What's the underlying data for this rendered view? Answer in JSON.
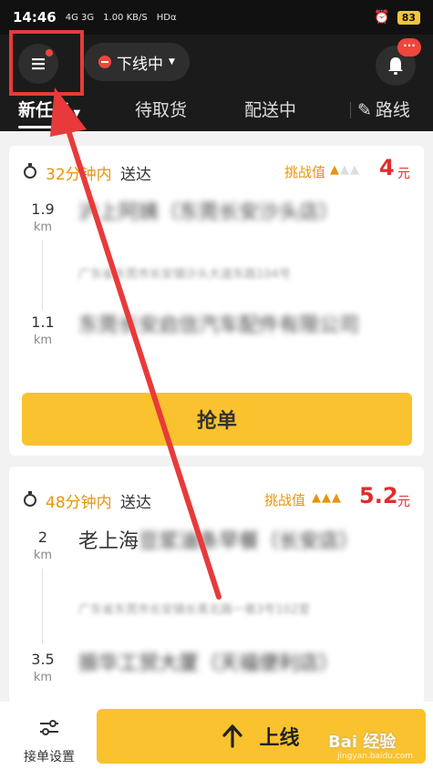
{
  "status_bar": {
    "time": "14:46",
    "signal": "4G 3G",
    "speed": "1.00 KB/S",
    "network": "HDα",
    "battery": "83"
  },
  "header": {
    "status_label": "下线中",
    "badge": "···"
  },
  "tabs": [
    {
      "label": "新任务"
    },
    {
      "label": "待取货"
    },
    {
      "label": "配送中"
    },
    {
      "label": "路线"
    }
  ],
  "orders": [
    {
      "time_limit": "32分钟内",
      "deliver": "送达",
      "challenge_label": "挑战值",
      "challenge_level": 1,
      "price": "4",
      "unit": "元",
      "pickup": {
        "distance": "1.9",
        "unit": "km",
        "name": "沪上阿姨（东莞长安沙头店）",
        "address": "广东省东莞市长安镇沙头大道东路104号"
      },
      "dropoff": {
        "distance": "1.1",
        "unit": "km",
        "name": "东莞长安启信汽车配件有限公司"
      },
      "grab_label": "抢单"
    },
    {
      "time_limit": "48分钟内",
      "deliver": "送达",
      "challenge_label": "挑战值",
      "challenge_level": 3,
      "price": "5.2",
      "unit": "元",
      "pickup": {
        "distance": "2",
        "unit": "km",
        "name_prefix": "老上海",
        "name_blur": "豆浆油条早餐（长安店）",
        "address": "广东省东莞市长安镇长青北路一巷3号102室"
      },
      "dropoff": {
        "distance": "3.5",
        "unit": "km",
        "name_blur": "振华工贸大厦（天福便利店）"
      }
    }
  ],
  "bottom": {
    "settings_label": "接单设置",
    "online_label": "上线"
  },
  "watermark": {
    "text": "Bai 经验",
    "sub": "jingyan.baidu.com"
  },
  "colors": {
    "accent": "#f9c22e",
    "price": "#e02d2d",
    "time": "#e8930c",
    "annotation": "#e83a3a"
  }
}
